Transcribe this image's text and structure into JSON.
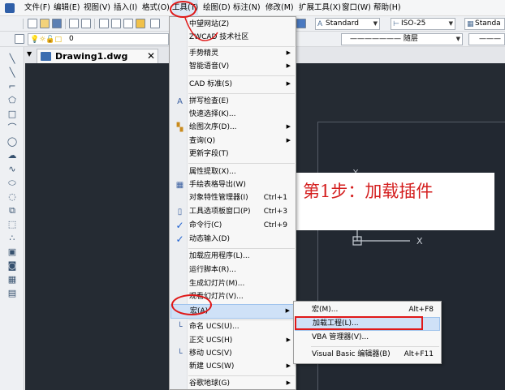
{
  "menubar": {
    "items": [
      "文件(F)",
      "编辑(E)",
      "视图(V)",
      "插入(I)",
      "格式(O)",
      "工具(T)",
      "绘图(D)",
      "标注(N)",
      "修改(M)",
      "扩展工具(X)",
      "窗口(W)",
      "帮助(H)"
    ]
  },
  "toolbar": {
    "text_style": "Standard",
    "dim_style": "ISO-25",
    "table_style": "Standa",
    "layer_value": "0",
    "linetype": "随层"
  },
  "document_tab": {
    "label": "Drawing1.dwg",
    "close": "✕"
  },
  "tools_menu": {
    "items": [
      {
        "label": "中望网站(Z)"
      },
      {
        "label": "ZWCAD 技术社区"
      },
      {
        "label": "手势精灵",
        "arrow": true
      },
      {
        "label": "智能语音(V)",
        "arrow": true
      },
      {
        "label": "CAD 标准(S)",
        "arrow": true
      },
      {
        "label": "拼写检查(E)",
        "icon": "spell-check-icon"
      },
      {
        "label": "快速选择(K)..."
      },
      {
        "label": "绘图次序(D)...",
        "arrow": true,
        "icon": "draw-order-icon"
      },
      {
        "label": "查询(Q)",
        "arrow": true
      },
      {
        "label": "更新字段(T)"
      },
      {
        "label": "属性提取(X)..."
      },
      {
        "label": "手绘表格导出(W)",
        "icon": "table-export-icon"
      },
      {
        "label": "对象特性管理器(I)",
        "shortcut": "Ctrl+1"
      },
      {
        "label": "工具选项板窗口(P)",
        "shortcut": "Ctrl+3",
        "icon": "tool-palette-icon"
      },
      {
        "label": "命令行(C)",
        "shortcut": "Ctrl+9",
        "checked": true
      },
      {
        "label": "动态输入(D)",
        "checked": true
      },
      {
        "label": "加载应用程序(L)..."
      },
      {
        "label": "运行脚本(R)..."
      },
      {
        "label": "生成幻灯片(M)..."
      },
      {
        "label": "观看幻灯片(V)..."
      },
      {
        "label": "宏(A)",
        "arrow": true
      },
      {
        "label": "命名 UCS(U)...",
        "icon": "ucs-named-icon"
      },
      {
        "label": "正交 UCS(H)",
        "arrow": true
      },
      {
        "label": "移动 UCS(V)",
        "icon": "ucs-move-icon"
      },
      {
        "label": "新建 UCS(W)",
        "arrow": true
      },
      {
        "label": "谷歌地球(G)",
        "arrow": true
      }
    ]
  },
  "macro_submenu": {
    "items": [
      {
        "label": "宏(M)...",
        "shortcut": "Alt+F8"
      },
      {
        "label": "加载工程(L)..."
      },
      {
        "label": "VBA 管理器(V)..."
      },
      {
        "label": "Visual Basic 编辑器(B)",
        "shortcut": "Alt+F11"
      }
    ]
  },
  "annotation": {
    "text": "第1步：加载插件"
  },
  "colors": {
    "canvas": "#252b33",
    "annotation_red": "#d41e1e",
    "highlight": "#cfe1f7"
  }
}
